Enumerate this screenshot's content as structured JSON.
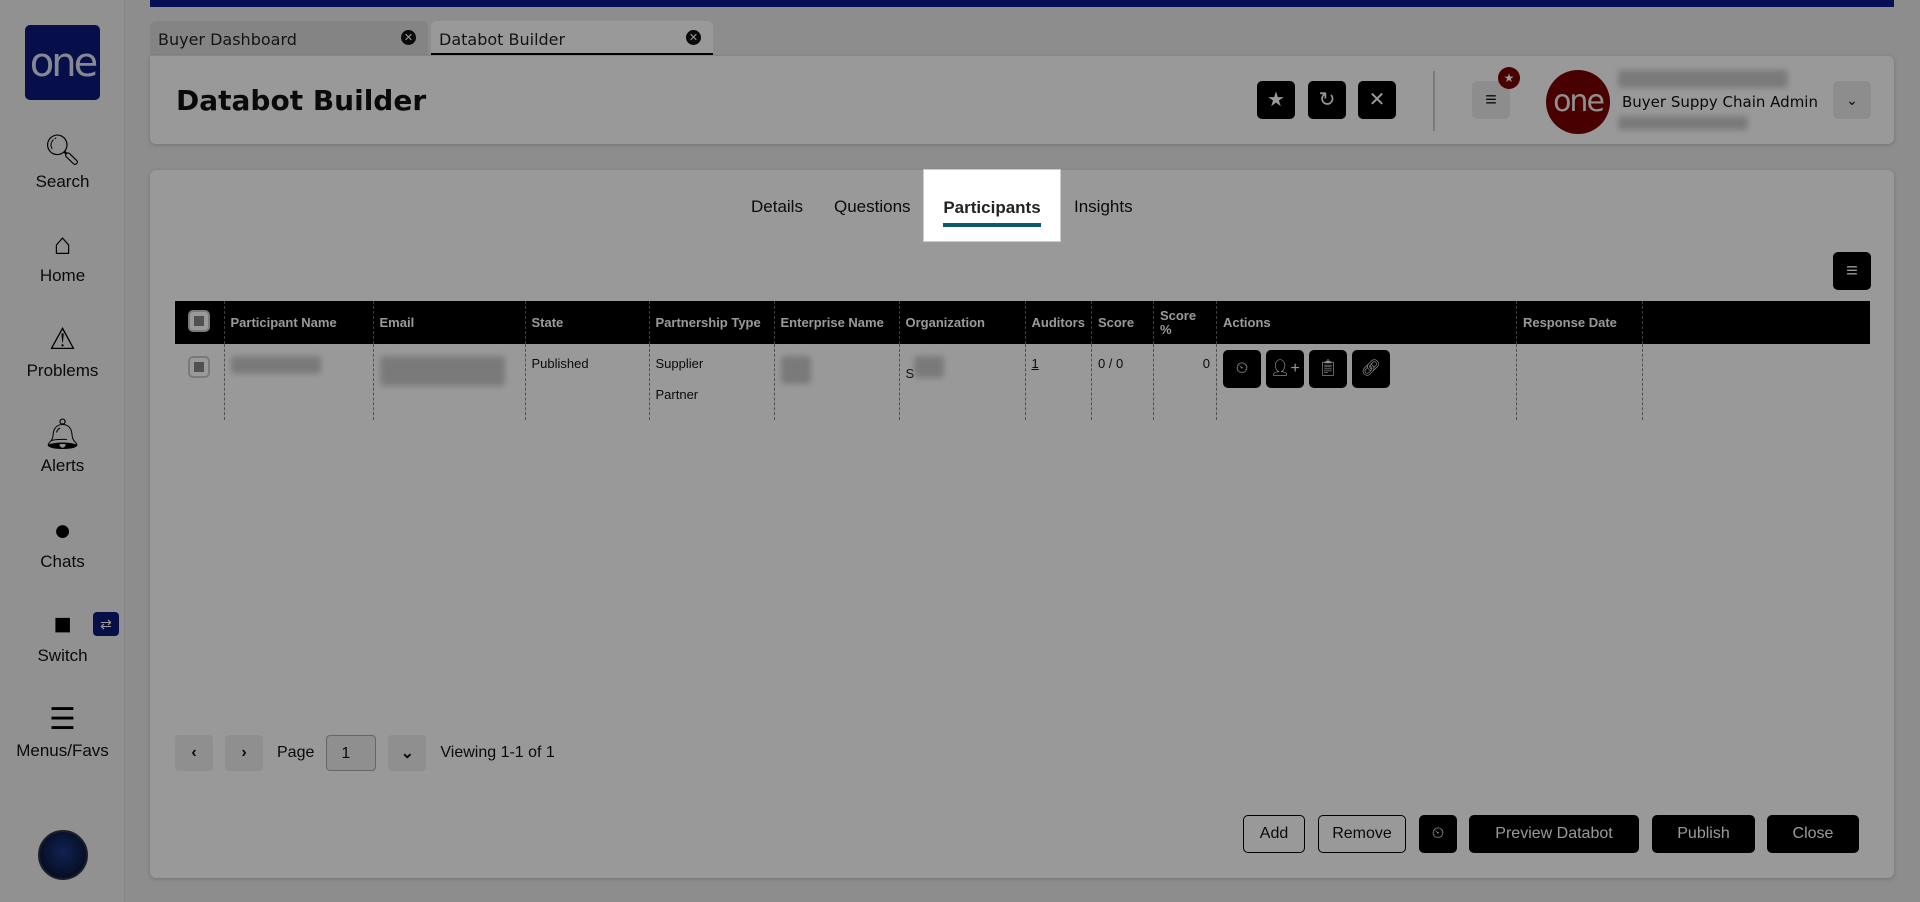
{
  "sidebar": {
    "logo": "one",
    "items": [
      {
        "label": "Search",
        "icon": "search-icon"
      },
      {
        "label": "Home",
        "icon": "home-icon"
      },
      {
        "label": "Problems",
        "icon": "warning-icon"
      },
      {
        "label": "Alerts",
        "icon": "bell-icon"
      },
      {
        "label": "Chats",
        "icon": "chat-icon"
      },
      {
        "label": "Switch",
        "icon": "switch-icon"
      },
      {
        "label": "Menus/Favs",
        "icon": "menu-icon"
      }
    ]
  },
  "tabs": [
    {
      "label": "Buyer Dashboard"
    },
    {
      "label": "Databot Builder",
      "active": true
    }
  ],
  "header": {
    "title": "Databot Builder",
    "role": "Buyer Suppy Chain Admin",
    "avatar_text": "one"
  },
  "main_tabs": [
    {
      "label": "Details"
    },
    {
      "label": "Questions"
    },
    {
      "label": "Participants",
      "active": true
    },
    {
      "label": "Insights"
    }
  ],
  "table": {
    "columns": [
      "Participant Name",
      "Email",
      "State",
      "Partnership Type",
      "Enterprise Name",
      "Organization",
      "Auditors",
      "Score",
      "Score %",
      "Actions",
      "Response Date"
    ],
    "rows": [
      {
        "state": "Published",
        "partnership": [
          "Supplier",
          "Partner"
        ],
        "org_prefix": "S",
        "auditors": "1",
        "score": "0 / 0",
        "score_pct": "0"
      }
    ]
  },
  "pagination": {
    "page_label": "Page",
    "page": "1",
    "viewing": "Viewing 1-1 of 1"
  },
  "footer": {
    "add": "Add",
    "remove": "Remove",
    "preview": "Preview Databot",
    "publish": "Publish",
    "close": "Close"
  },
  "colors": {
    "brand": "#0a1a7a",
    "accent": "#0b5a6a",
    "avatar": "#7a0000"
  }
}
